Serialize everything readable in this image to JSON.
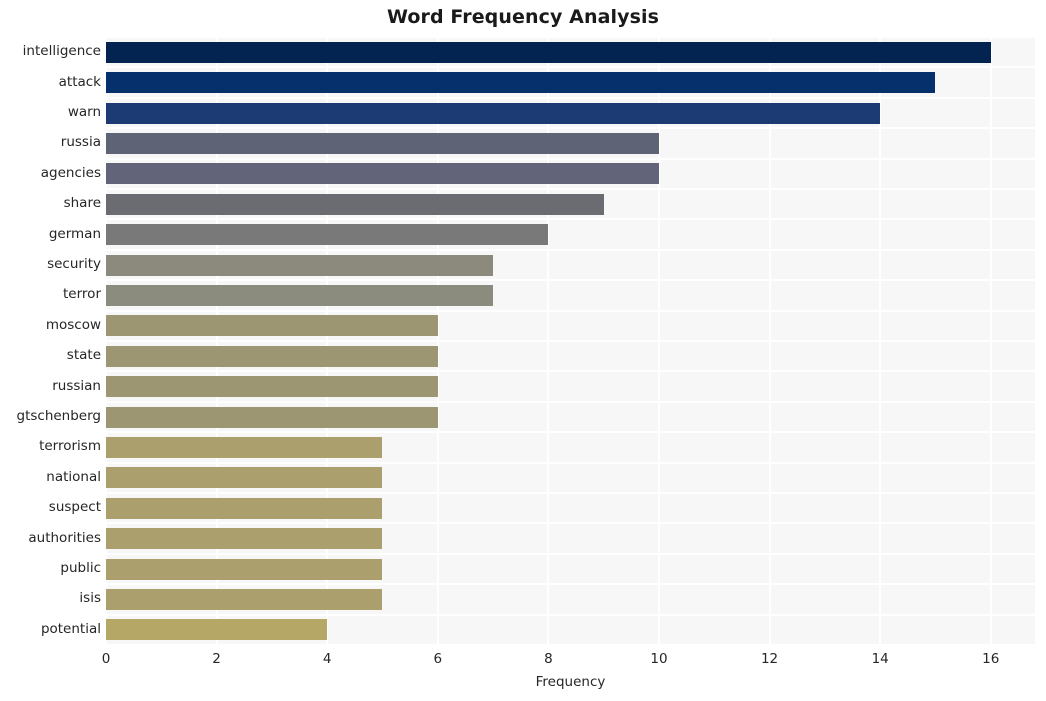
{
  "chart_data": {
    "type": "bar",
    "orientation": "horizontal",
    "title": "Word Frequency Analysis",
    "xlabel": "Frequency",
    "ylabel": "",
    "xlim": [
      0,
      16.8
    ],
    "ylim_categories": 20,
    "xticks": [
      0,
      2,
      4,
      6,
      8,
      10,
      12,
      14,
      16
    ],
    "xtick_labels": [
      "0",
      "2",
      "4",
      "6",
      "8",
      "10",
      "12",
      "14",
      "16"
    ],
    "grid": true,
    "grid_color": "#ffffff",
    "plot_background": "#f7f7f7",
    "figure_background": "#ffffff",
    "legend": null,
    "categories": [
      "intelligence",
      "attack",
      "warn",
      "russia",
      "agencies",
      "share",
      "german",
      "security",
      "terror",
      "moscow",
      "state",
      "russian",
      "gtschenberg",
      "terrorism",
      "national",
      "suspect",
      "authorities",
      "public",
      "isis",
      "potential"
    ],
    "values": [
      16,
      15,
      14,
      10,
      10,
      9,
      8,
      7,
      7,
      6,
      6,
      6,
      6,
      5,
      5,
      5,
      5,
      5,
      5,
      4
    ],
    "bar_colors": [
      "#032450",
      "#05306b",
      "#1c3a73",
      "#5e6375",
      "#62657a",
      "#6a6c72",
      "#79797a",
      "#8b8a7d",
      "#8b8b7e",
      "#9c9673",
      "#9c9673",
      "#9c9673",
      "#9c9673",
      "#aa9f6d",
      "#aa9f6d",
      "#aa9f6d",
      "#aa9f6d",
      "#aa9f6d",
      "#aa9f6d",
      "#b5a867"
    ],
    "colormap": "cividis",
    "series": [
      {
        "name": "Frequency",
        "values": [
          16,
          15,
          14,
          10,
          10,
          9,
          8,
          7,
          7,
          6,
          6,
          6,
          6,
          5,
          5,
          5,
          5,
          5,
          5,
          4
        ]
      }
    ]
  }
}
